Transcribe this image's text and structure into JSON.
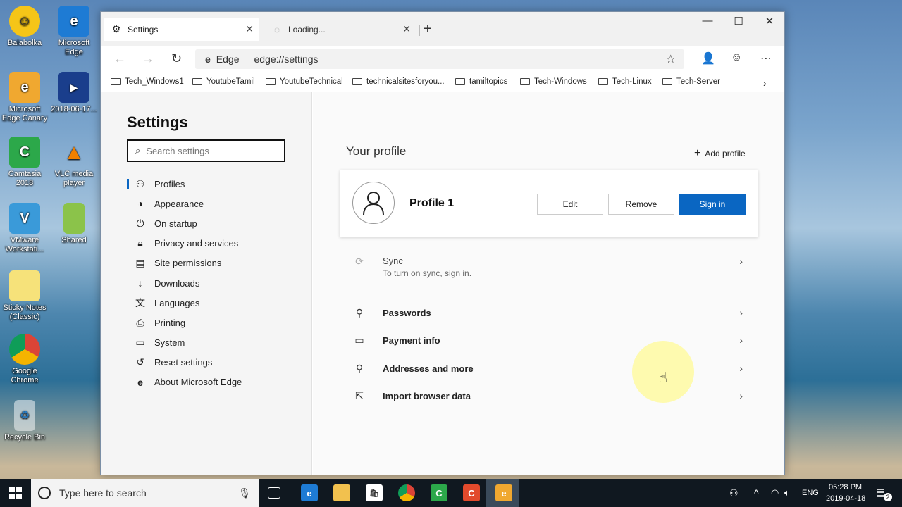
{
  "desktop": {
    "icons": [
      {
        "label": "Balabolka",
        "icon": "smiley-icon"
      },
      {
        "label": "Microsoft Edge",
        "icon": "edge-icon"
      },
      {
        "label": "Microsoft Edge Canary",
        "icon": "edge-canary-icon"
      },
      {
        "label": "2018-06-17...",
        "icon": "video-icon"
      },
      {
        "label": "Camtasia 2018",
        "icon": "camtasia-icon"
      },
      {
        "label": "VLC media player",
        "icon": "vlc-icon"
      },
      {
        "label": "VMware Workstati...",
        "icon": "vmware-icon"
      },
      {
        "label": "Shared",
        "icon": "folder-icon"
      },
      {
        "label": "Sticky Notes (Classic)",
        "icon": "sticky-icon"
      },
      {
        "label": "Google Chrome",
        "icon": "chrome-icon"
      },
      {
        "label": "Recycle Bin",
        "icon": "recycle-icon"
      }
    ]
  },
  "browser": {
    "tabs": [
      {
        "title": "Settings",
        "active": true
      },
      {
        "title": "Loading...",
        "active": false
      }
    ],
    "address": {
      "prefix": "Edge",
      "url": "edge://settings"
    },
    "favorites": [
      "Tech_Windows1",
      "YoutubeTamil",
      "YoutubeTechnical",
      "technicalsitesforyou...",
      "tamiltopics",
      "Tech-Windows",
      "Tech-Linux",
      "Tech-Server"
    ]
  },
  "sidebar": {
    "title": "Settings",
    "search_placeholder": "Search settings",
    "items": [
      {
        "label": "Profiles",
        "icon": "person-icon"
      },
      {
        "label": "Appearance",
        "icon": "palette-icon"
      },
      {
        "label": "On startup",
        "icon": "power-icon"
      },
      {
        "label": "Privacy and services",
        "icon": "lock-icon"
      },
      {
        "label": "Site permissions",
        "icon": "permissions-icon"
      },
      {
        "label": "Downloads",
        "icon": "download-icon"
      },
      {
        "label": "Languages",
        "icon": "language-icon"
      },
      {
        "label": "Printing",
        "icon": "printer-icon"
      },
      {
        "label": "System",
        "icon": "laptop-icon"
      },
      {
        "label": "Reset settings",
        "icon": "reset-icon"
      },
      {
        "label": "About Microsoft Edge",
        "icon": "edge-icon"
      }
    ]
  },
  "profile": {
    "section_title": "Your profile",
    "add_profile": "Add profile",
    "name": "Profile 1",
    "edit": "Edit",
    "remove": "Remove",
    "sign_in": "Sign in",
    "rows": [
      {
        "label": "Sync",
        "sub": "To turn on sync, sign in.",
        "icon": "sync-icon"
      },
      {
        "label": "Passwords",
        "icon": "key-icon"
      },
      {
        "label": "Payment info",
        "icon": "card-icon"
      },
      {
        "label": "Addresses and more",
        "icon": "location-icon"
      },
      {
        "label": "Import browser data",
        "icon": "import-icon"
      }
    ]
  },
  "taskbar": {
    "search_placeholder": "Type here to search",
    "language": "ENG",
    "time": "05:28 PM",
    "date": "2019-04-18",
    "notifications": "2"
  },
  "colors": {
    "accent": "#0a66c2",
    "taskbar": "#101820"
  }
}
